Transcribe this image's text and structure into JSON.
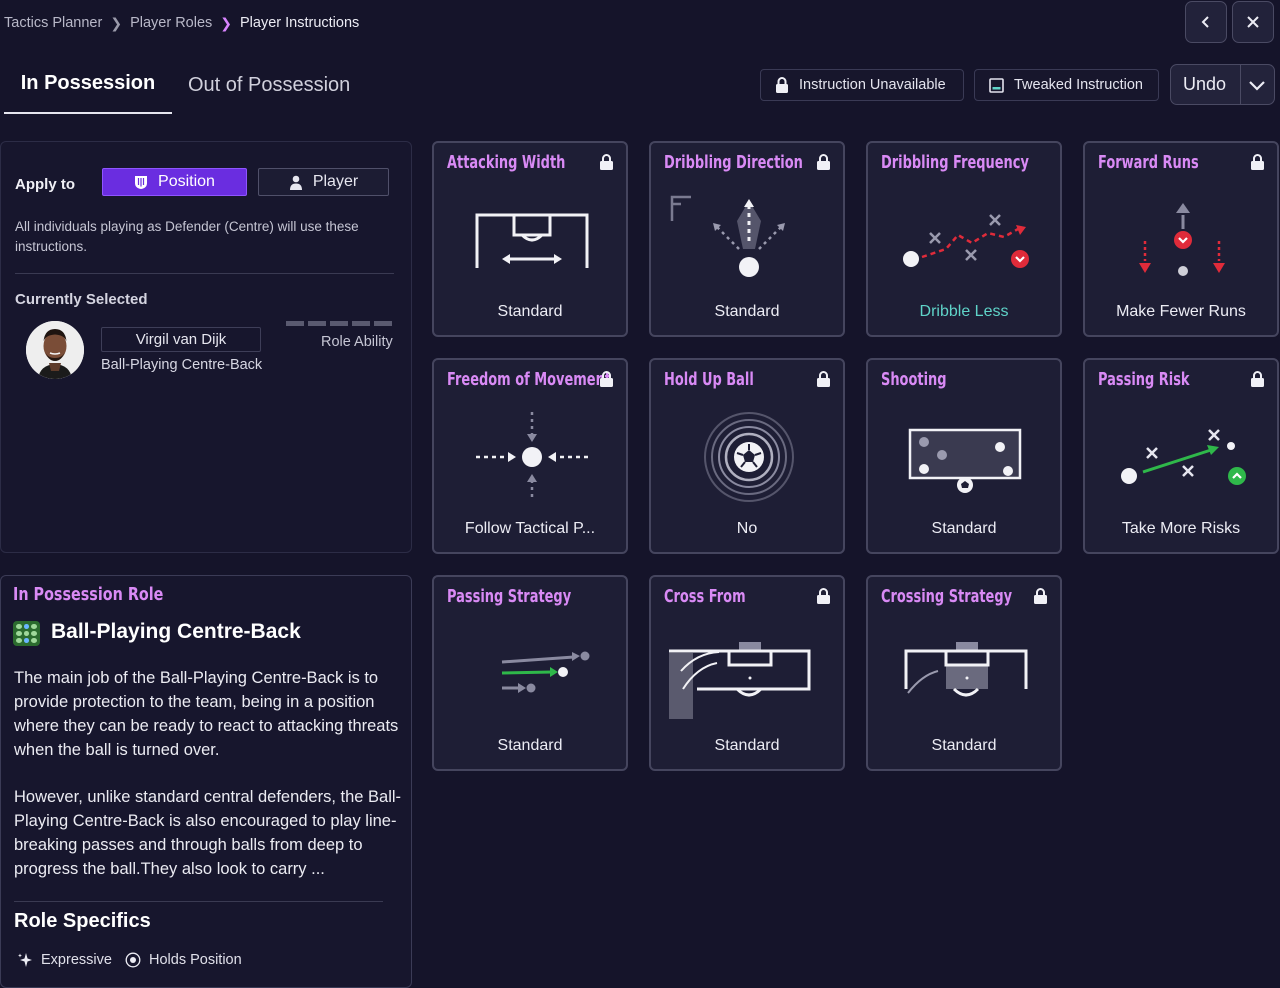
{
  "breadcrumb": [
    "Tactics Planner",
    "Player Roles",
    "Player Instructions"
  ],
  "tabs": {
    "in_possession": "In Possession",
    "out_of_possession": "Out of Possession"
  },
  "legend": {
    "unavailable": "Instruction Unavailable",
    "tweaked": "Tweaked Instruction"
  },
  "undo": "Undo",
  "apply": {
    "label": "Apply to",
    "position": "Position",
    "player": "Player",
    "description": "All individuals playing as Defender (Centre) will use these instructions."
  },
  "current": {
    "title": "Currently Selected",
    "player_name": "Virgil van Dijk",
    "role": "Ball-Playing Centre-Back",
    "role_ability_label": "Role Ability",
    "role_ability_stars": 0
  },
  "role": {
    "section_title": "In Possession Role",
    "name": "Ball-Playing Centre-Back",
    "paragraph1": "The main job of the Ball-Playing Centre-Back is to provide protection to the team, being in a position where they can be ready to react to attacking threats when the ball is turned over.",
    "paragraph2": "However, unlike standard central defenders, the Ball-Playing Centre-Back is also encouraged to play line-breaking passes and through balls from deep to progress the ball.They also look to carry ...",
    "specifics_title": "Role Specifics",
    "specifics": [
      "Expressive",
      "Holds Position"
    ]
  },
  "instructions": [
    {
      "title": "Attacking Width",
      "value": "Standard",
      "locked": true,
      "icon": "width-pitch-icon"
    },
    {
      "title": "Dribbling Direction",
      "value": "Standard",
      "locked": true,
      "icon": "dribble-direction-icon"
    },
    {
      "title": "Dribbling Frequency",
      "value": "Dribble Less",
      "locked": false,
      "tweaked": true,
      "icon": "dribble-frequency-icon"
    },
    {
      "title": "Forward Runs",
      "value": "Make Fewer Runs",
      "locked": true,
      "icon": "forward-runs-icon"
    },
    {
      "title": "Freedom of Movement",
      "value": "Follow Tactical P...",
      "locked": true,
      "icon": "freedom-movement-icon"
    },
    {
      "title": "Hold Up Ball",
      "value": "No",
      "locked": true,
      "icon": "hold-up-ball-icon"
    },
    {
      "title": "Shooting",
      "value": "Standard",
      "locked": false,
      "icon": "shooting-icon"
    },
    {
      "title": "Passing Risk",
      "value": "Take More Risks",
      "locked": true,
      "icon": "passing-risk-icon"
    },
    {
      "title": "Passing Strategy",
      "value": "Standard",
      "locked": false,
      "icon": "passing-strategy-icon"
    },
    {
      "title": "Cross From",
      "value": "Standard",
      "locked": true,
      "icon": "cross-from-icon"
    },
    {
      "title": "Crossing Strategy",
      "value": "Standard",
      "locked": true,
      "icon": "crossing-strategy-icon"
    }
  ],
  "colors": {
    "accent": "#d98af5",
    "position_selected": "#6a2de0",
    "tweaked_value": "#5fd3c8",
    "background": "#15142a"
  }
}
